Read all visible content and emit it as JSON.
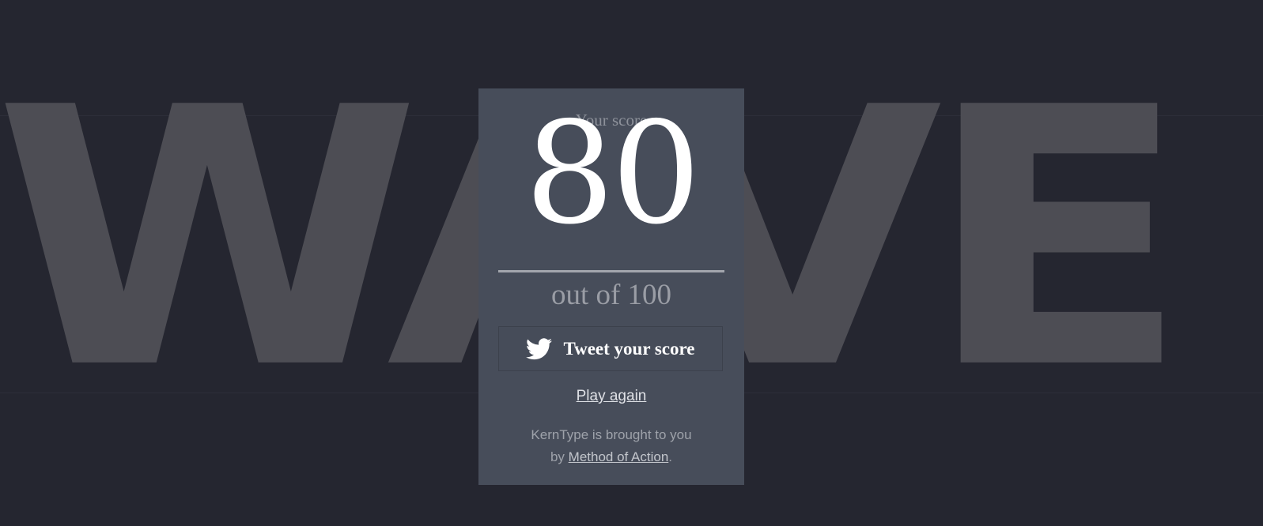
{
  "background_word": "WAVE",
  "result": {
    "score_label": "Your score",
    "score": "80",
    "out_of": "out of 100"
  },
  "actions": {
    "tweet_label": "Tweet your score",
    "tweet_icon": "twitter-bird-icon",
    "play_again_label": "Play again"
  },
  "credit": {
    "line1": "KernType is brought to you",
    "by": "by",
    "link_text": "Method of Action",
    "end": "."
  },
  "colors": {
    "page_background": "#252630",
    "card_background": "#474d5a",
    "background_word": "#4d4d54",
    "score": "#ffffff"
  }
}
